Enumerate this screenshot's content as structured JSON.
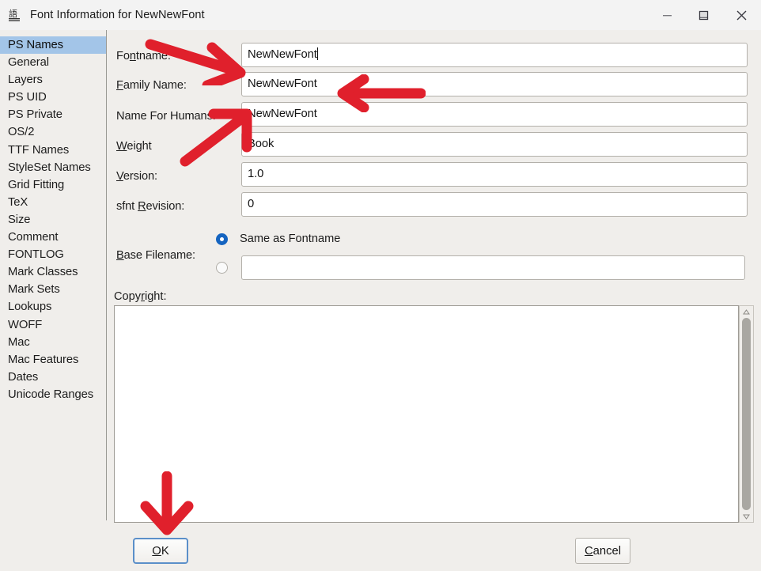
{
  "window": {
    "title": "Font Information for NewNewFont",
    "icon": "font-glyph-icon",
    "controls": {
      "minimize": "minimize-icon",
      "maximize": "maximize-icon",
      "close": "close-icon"
    }
  },
  "sidebar": {
    "selected": "PS Names",
    "items": [
      {
        "label": "PS Names"
      },
      {
        "label": "General"
      },
      {
        "label": "Layers"
      },
      {
        "label": "PS UID"
      },
      {
        "label": "PS Private"
      },
      {
        "label": "OS/2"
      },
      {
        "label": "TTF Names"
      },
      {
        "label": "StyleSet Names"
      },
      {
        "label": "Grid Fitting"
      },
      {
        "label": "TeX"
      },
      {
        "label": "Size"
      },
      {
        "label": "Comment"
      },
      {
        "label": "FONTLOG"
      },
      {
        "label": "Mark Classes"
      },
      {
        "label": "Mark Sets"
      },
      {
        "label": "Lookups"
      },
      {
        "label": "WOFF"
      },
      {
        "label": "Mac"
      },
      {
        "label": "Mac Features"
      },
      {
        "label": "Dates"
      },
      {
        "label": "Unicode Ranges"
      }
    ]
  },
  "form": {
    "fontname": {
      "label": "Fontname:",
      "value": "NewNewFont"
    },
    "family_name": {
      "label": "Family Name:",
      "value": "NewNewFont"
    },
    "name_for_humans": {
      "label": "Name For Humans:",
      "value": "NewNewFont"
    },
    "weight": {
      "label": "Weight",
      "value": "Book"
    },
    "version": {
      "label": "Version:",
      "value": "1.0"
    },
    "sfnt_revision": {
      "label": "sfnt Revision:",
      "value": "0"
    },
    "base_filename": {
      "label": "Base Filename:",
      "option_same_as_fontname": "Same as Fontname",
      "selected_option": "Same as Fontname",
      "custom_value": ""
    },
    "copyright": {
      "label": "Copyright:",
      "value": ""
    }
  },
  "buttons": {
    "ok": "OK",
    "cancel": "Cancel"
  },
  "annotations": {
    "accent_color": "#e0202c",
    "arrows": [
      {
        "name": "arrow-to-fontname",
        "direction": "right-down"
      },
      {
        "name": "arrow-to-family-name",
        "direction": "left"
      },
      {
        "name": "arrow-to-name-for-humans",
        "direction": "right-up"
      },
      {
        "name": "arrow-to-ok-button",
        "direction": "down"
      }
    ]
  },
  "colors": {
    "dialog_background": "#f0eeeb",
    "titlebar_background": "#f3f3f3",
    "selection_blue": "#a3c5e8",
    "radio_blue": "#1564c0",
    "focus_blue": "#5b8fc9"
  }
}
